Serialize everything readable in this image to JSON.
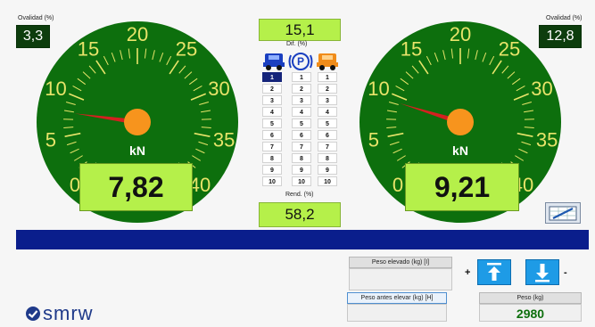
{
  "left_gauge": {
    "ovalidad_label": "Ovalidad (%)",
    "ovalidad_value": "3,3",
    "unit": "kN",
    "value": "7,82",
    "ticks": [
      "0",
      "5",
      "10",
      "15",
      "20",
      "25",
      "30",
      "35",
      "40"
    ]
  },
  "right_gauge": {
    "ovalidad_label": "Ovalidad (%)",
    "ovalidad_value": "12,8",
    "unit": "kN",
    "value": "9,21",
    "ticks": [
      "0",
      "5",
      "10",
      "15",
      "20",
      "25",
      "30",
      "35",
      "40"
    ]
  },
  "center": {
    "dif_value": "15,1",
    "dif_label": "Dif. (%)",
    "rend_label": "Rend. (%)",
    "rend_value": "58,2",
    "rows": [
      "1",
      "2",
      "3",
      "4",
      "5",
      "6",
      "7",
      "8",
      "9",
      "10"
    ],
    "selected_row": "1"
  },
  "bottom": {
    "peso_elevado_label": "Peso elevado (kg) [I]",
    "peso_antes_label": "Peso antes elevar (kg) [H]",
    "peso_label": "Peso (kg)",
    "peso_value": "2980",
    "plus_label": "+",
    "minus_label": "-",
    "logo_text": "smrw"
  },
  "colors": {
    "gauge_green": "#0d6f0d",
    "tick_yellow": "#e8e46a",
    "needle_red": "#d42020",
    "hub_orange": "#f7941d",
    "bar_blue": "#0a1e8c",
    "accent_cyan": "#1e9be6"
  }
}
